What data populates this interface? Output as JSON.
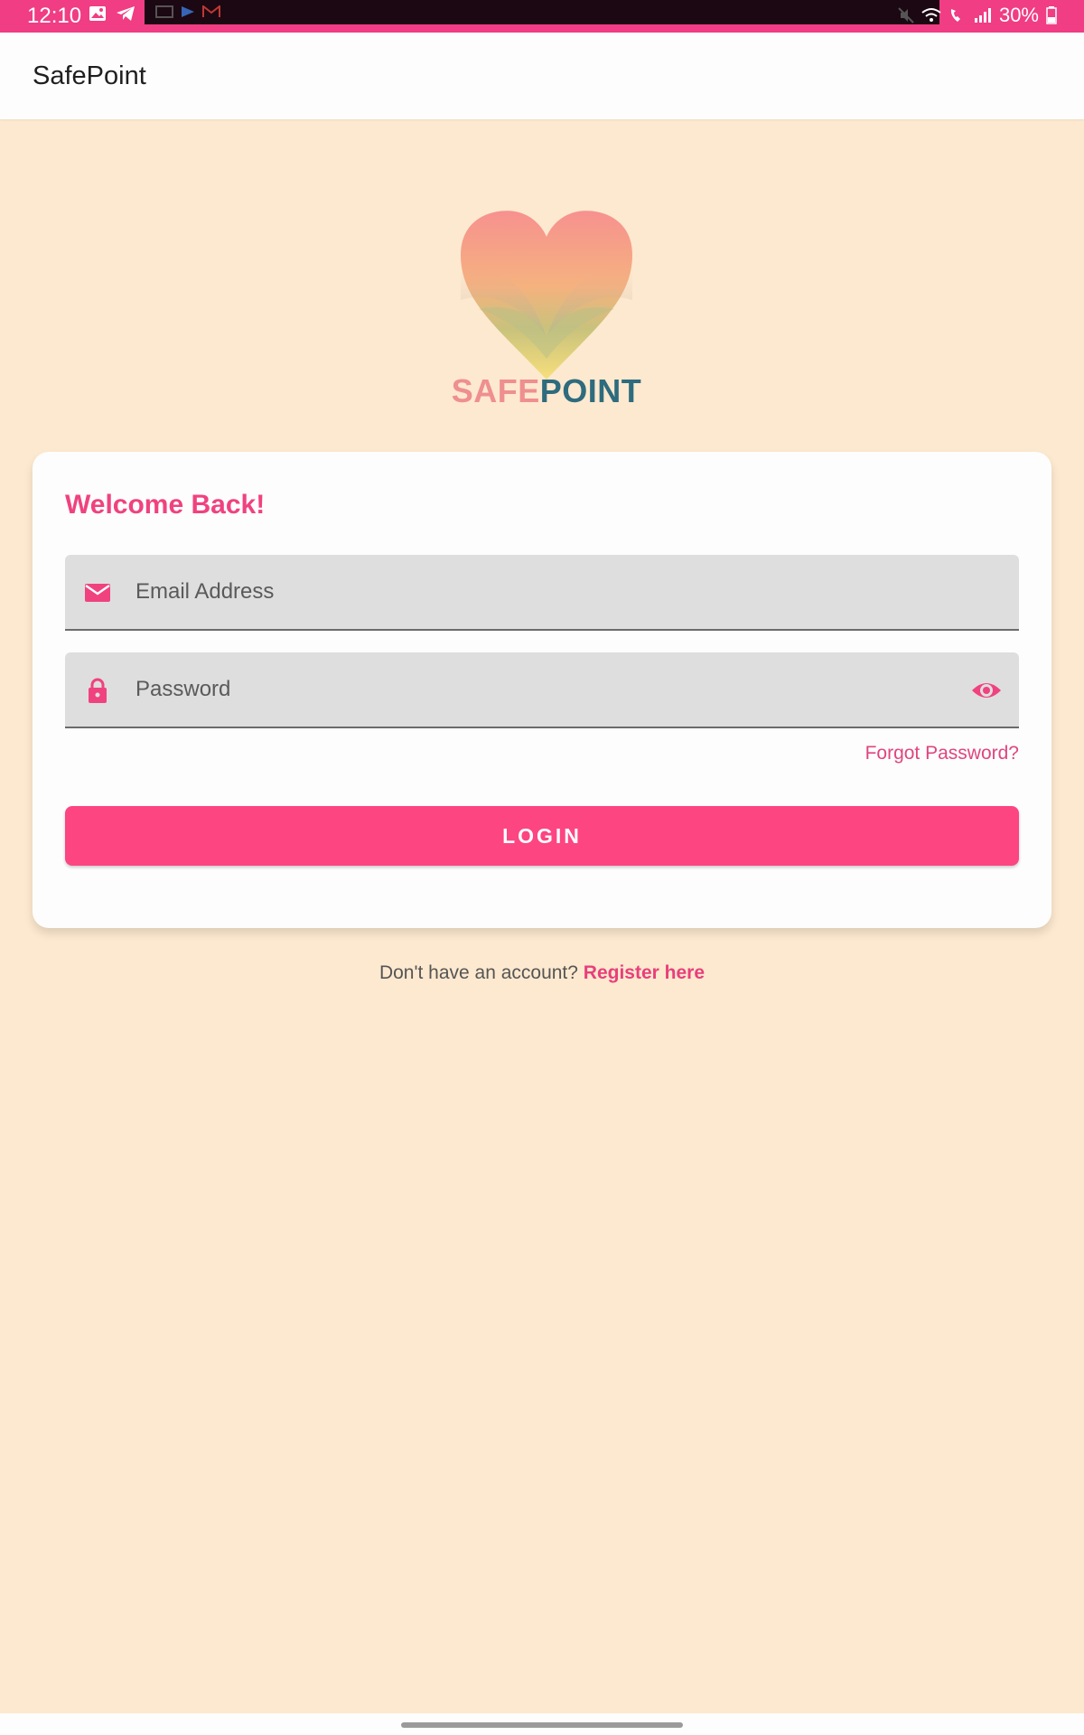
{
  "status_bar": {
    "time": "12:10",
    "battery": "30%",
    "background_color": "#f03d84"
  },
  "app_bar": {
    "title": "SafePoint"
  },
  "logo": {
    "text_part1": "SAFE",
    "text_part2": "POINT",
    "heart_colors": [
      "#f7918f",
      "#f5b27f",
      "#c7c47b",
      "#f7df7c"
    ]
  },
  "login_card": {
    "welcome_title": "Welcome Back!",
    "email": {
      "placeholder": "Email Address",
      "icon": "mail-icon"
    },
    "password": {
      "placeholder": "Password",
      "icon": "lock-icon",
      "toggle_icon": "eye-icon"
    },
    "forgot_password": "Forgot Password?",
    "login_button": "LOGIN"
  },
  "register_prompt": {
    "text": "Don't have an account?",
    "link": "Register here"
  },
  "colors": {
    "accent": "#fd4582",
    "background": "#fde9cf",
    "card": "#fdfdfd"
  }
}
